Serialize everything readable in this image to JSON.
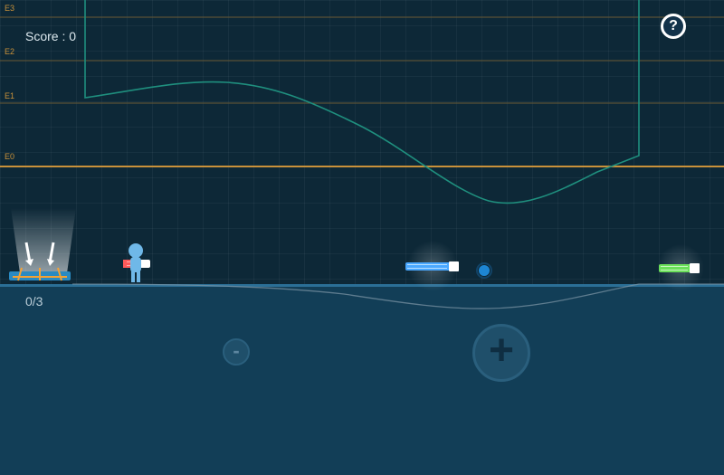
{
  "hud": {
    "score_label": "Score : 0",
    "collected_counter": "0/3",
    "help_icon": "question-mark-icon"
  },
  "energy_levels": [
    {
      "label": "E3"
    },
    {
      "label": "E2"
    },
    {
      "label": "E1"
    },
    {
      "label": "E0"
    }
  ],
  "controls": {
    "minus_label": "-",
    "plus_label": "+"
  },
  "colors": {
    "background": "#0d2837",
    "ground": "#123e57",
    "energy_line": "#c9913a",
    "potential_curve": "#1f8f7e",
    "red_battery": "#ff5a5a",
    "blue_battery": "#4aa8ff",
    "green_battery": "#6be05a",
    "character": "#6fb8e8"
  },
  "icons": [
    "question-mark-icon",
    "arrow-down-icon",
    "battery-icon",
    "character-icon",
    "ball-icon"
  ]
}
